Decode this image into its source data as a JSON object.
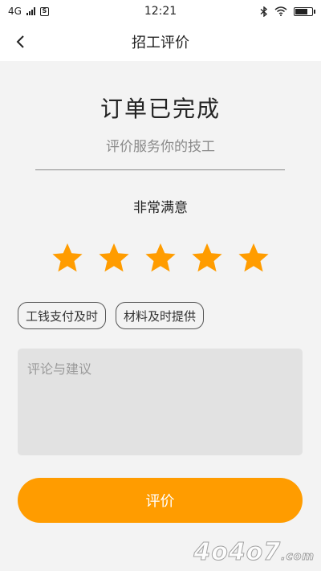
{
  "status_bar": {
    "network": "4G",
    "time": "12:21",
    "sim_icon_label": "S",
    "battery_level": 0.85,
    "icons": [
      "signal-icon",
      "sim-icon",
      "bluetooth-icon",
      "wifi-icon",
      "battery-icon"
    ]
  },
  "nav": {
    "title": "招工评价",
    "back_icon": "chevron-left-icon"
  },
  "order": {
    "status_title": "订单已完成",
    "subtitle": "评价服务你的技工"
  },
  "rating": {
    "label": "非常满意",
    "value": 5,
    "max": 5,
    "star_color": "#ff9c00"
  },
  "tags": [
    {
      "label": "工钱支付及时"
    },
    {
      "label": "材料及时提供"
    }
  ],
  "comment": {
    "placeholder": "评论与建议",
    "value": ""
  },
  "submit": {
    "label": "评价",
    "color": "#ff9c00"
  },
  "watermark": {
    "text": "4o4o7",
    "suffix": ".com"
  }
}
